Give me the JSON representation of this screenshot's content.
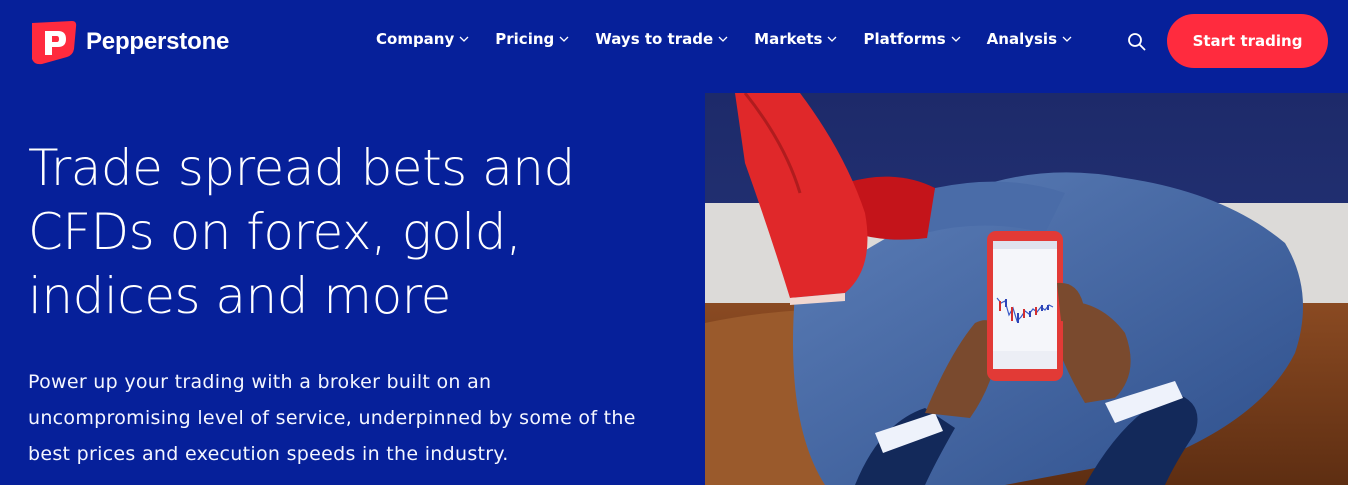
{
  "brand": {
    "name": "Pepperstone",
    "logo_letter": "P",
    "logo_color": "#ff2b3e"
  },
  "nav": {
    "items": [
      {
        "label": "Company",
        "icon": "chevron-down-icon"
      },
      {
        "label": "Pricing",
        "icon": "chevron-down-icon"
      },
      {
        "label": "Ways to trade",
        "icon": "chevron-down-icon"
      },
      {
        "label": "Markets",
        "icon": "chevron-down-icon"
      },
      {
        "label": "Platforms",
        "icon": "chevron-down-icon"
      },
      {
        "label": "Analysis",
        "icon": "chevron-down-icon"
      }
    ],
    "search_icon": "search-icon",
    "cta_label": "Start trading"
  },
  "hero": {
    "title_lines": [
      "Trade spread bets and",
      "CFDs on forex, gold,",
      "indices and more"
    ],
    "subtitle_lines": [
      "Power up your trading with a broker built on an",
      "uncompromising level of service, underpinned by some of the",
      "best prices and execution speeds in the industry."
    ]
  },
  "colors": {
    "background": "#06209a",
    "accent": "#ff2b3e",
    "text": "#ffffff"
  }
}
